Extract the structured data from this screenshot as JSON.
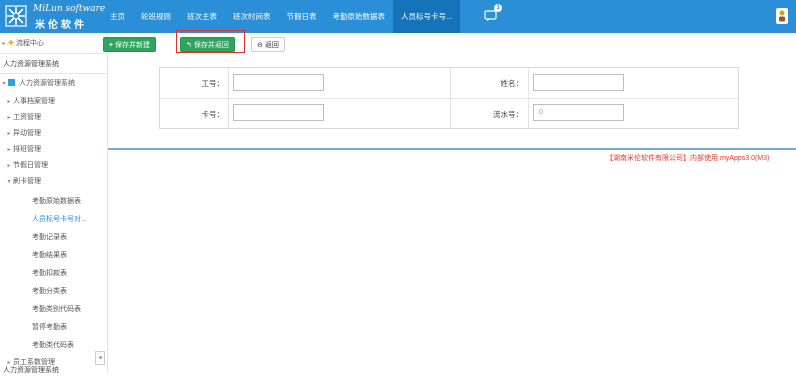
{
  "logo": {
    "english": "MiLun software",
    "chinese": "米伦软件"
  },
  "nav": {
    "items": [
      "主页",
      "轮班规则",
      "班次主表",
      "班次时间表",
      "节假日表",
      "考勤原始数据表",
      "人员标号卡号..."
    ],
    "badge": "3"
  },
  "sidebar": {
    "workflow": "流程中心",
    "system_header": "人力资源管理系统",
    "system_node": "人力资源管理系统",
    "items": [
      "人事档案管理",
      "工资管理",
      "异动管理",
      "排班管理",
      "节假日管理"
    ],
    "attendance_group": "刷卡管理",
    "sub_items": [
      "考勤原始数据表",
      "人员标号卡号对...",
      "考勤记录表",
      "考勤结果表",
      "考勤扣款表",
      "考勤分类表",
      "考勤类别代码表",
      "暂停考勤表",
      "考勤类代码表"
    ],
    "more_group": "员工系数管理",
    "bottom_label": "人力资源管理系统",
    "toggle_glyph": "◂"
  },
  "toolbar": {
    "save_new": "保存并新建",
    "save_return": "保存并返回",
    "back": "返回"
  },
  "form": {
    "labels": {
      "employee_id": "工号：",
      "name": "姓名：",
      "card_no": "卡号：",
      "serial_no": "流水号："
    },
    "values": {
      "employee_id": "",
      "name": "",
      "card_no": "",
      "serial_no": "0"
    }
  },
  "footer": "【湖南米伦软件有限公司】内部使用 myApps3.0(M3)",
  "colors": {
    "topbar": "#2a8fd6",
    "active_tab": "#1673ba",
    "green_button": "#2ea55f",
    "highlight": "#e0302a",
    "footer_text": "#e23a2b",
    "active_link": "#2a8fd6"
  }
}
